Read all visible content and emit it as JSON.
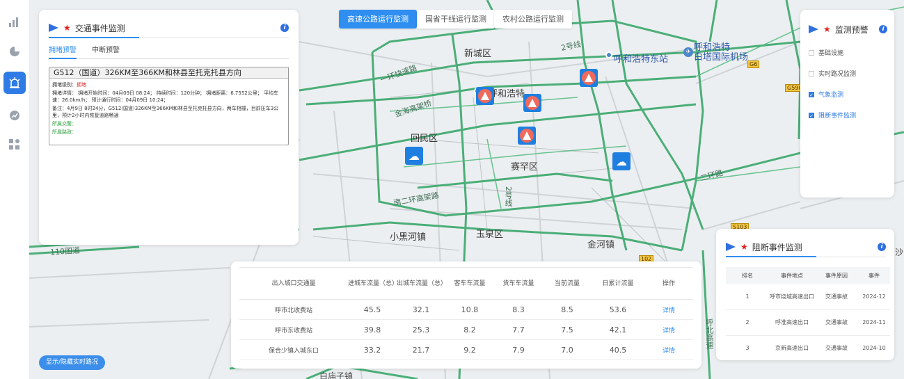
{
  "top_tabs": [
    {
      "label": "高速公路运行监测",
      "active": true
    },
    {
      "label": "国省干线运行监测",
      "active": false
    },
    {
      "label": "农村公路运行监测",
      "active": false
    }
  ],
  "sidebar": {
    "items": [
      {
        "icon": "bar-chart-icon",
        "active": false
      },
      {
        "icon": "pie-chart-icon",
        "active": false
      },
      {
        "icon": "alarm-icon",
        "active": true
      },
      {
        "icon": "trend-icon",
        "active": false
      },
      {
        "icon": "apps-icon",
        "active": false
      }
    ]
  },
  "map": {
    "labels": {
      "xinchengqu": "新城区",
      "huhehaote": "呼和浩特",
      "huhehaote_east": "呼和浩特东站",
      "airport": "呼和浩特\n白塔国际机场",
      "huiminqu": "回民区",
      "saihanqu": "赛罕区",
      "yuquanqu": "玉泉区",
      "xiaoheihe": "小黑河镇",
      "jinhezhen": "金河镇",
      "baimiaozi": "白庙子镇",
      "road_huanlu_1": "一环快速路",
      "road_jinhai": "金海高架桥",
      "road_nanerhuan": "南二环高架路",
      "road_2hao_1": "2号线",
      "road_2hao_2": "2号线",
      "road_huanlu_2": "二环路",
      "road_110": "110国道",
      "road_vert": "呼北高速",
      "shield_g6": "G6",
      "shield_g5901": "G5901",
      "shield_g102": "102",
      "shield_s103": "S103",
      "edge_sha": "沙"
    }
  },
  "traffic_panel": {
    "title": "交通事件监测",
    "tabs": [
      {
        "label": "拥堵预警",
        "active": true
      },
      {
        "label": "中断预警",
        "active": false
      }
    ],
    "event": {
      "title": "G512（国道）326KM至366KM和林县至托克托县方向",
      "level_label": "拥堵级别：",
      "level_value": "拥堵",
      "detail": "拥堵详情：  拥堵开始时间：04月09日 08:24；  持续时间：120分钟；  拥堵距离：6.7552公里；  平均车速：26.0km/h；  预计通行时间：04月09日 10:24；",
      "note": "备注：4月9日 8时24分，G512(国道)326KM至366KM和林县至托克托县方向，两车相撞，目前压车3公里，预计2小时内恢复道路畅通",
      "police_label": "所属交警：",
      "road_admin_label": "所属路政："
    }
  },
  "monitor_panel": {
    "title": "监测预警",
    "items": [
      {
        "label": "基础设施",
        "checked": false
      },
      {
        "label": "实时路况监测",
        "checked": false
      },
      {
        "label": "气象监测",
        "checked": true
      },
      {
        "label": "阻断事件监测",
        "checked": true
      }
    ]
  },
  "block_panel": {
    "title": "阻断事件监测",
    "columns": [
      "排名",
      "事件地点",
      "事件原因",
      "事件"
    ],
    "rows": [
      {
        "rank": "1",
        "place": "呼市绕城高速出口",
        "reason": "交通事故",
        "time": "2024-12"
      },
      {
        "rank": "2",
        "place": "呼准高速出口",
        "reason": "交通事故",
        "time": "2024-11"
      },
      {
        "rank": "3",
        "place": "京新高速出口",
        "reason": "交通事故",
        "time": "2024-10"
      }
    ]
  },
  "flow_table": {
    "columns": [
      "出入城口交通量",
      "进城车流量（总）",
      "出城车流量（总）",
      "客车车流量",
      "货车车流量",
      "当前流量",
      "日累计流量",
      "操作"
    ],
    "rows": [
      {
        "name": "呼市北收费站",
        "in": "45.5",
        "out": "32.1",
        "bus": "10.8",
        "truck": "8.3",
        "current": "8.5",
        "daily": "53.6",
        "op": "详情"
      },
      {
        "name": "呼市东收费站",
        "in": "39.8",
        "out": "25.3",
        "bus": "8.2",
        "truck": "7.7",
        "current": "7.5",
        "daily": "42.1",
        "op": "详情"
      },
      {
        "name": "保合少镇入城东口",
        "in": "33.2",
        "out": "21.7",
        "bus": "9.2",
        "truck": "7.9",
        "current": "7.0",
        "daily": "40.5",
        "op": "详情"
      }
    ]
  },
  "toggle_button": {
    "label": "显示/隐藏实时路况"
  },
  "colors": {
    "accent": "#2f8ef0",
    "road": "#3aa86b",
    "alert": "#ef6a5c",
    "sidebar_active": "#2f7ce6"
  }
}
